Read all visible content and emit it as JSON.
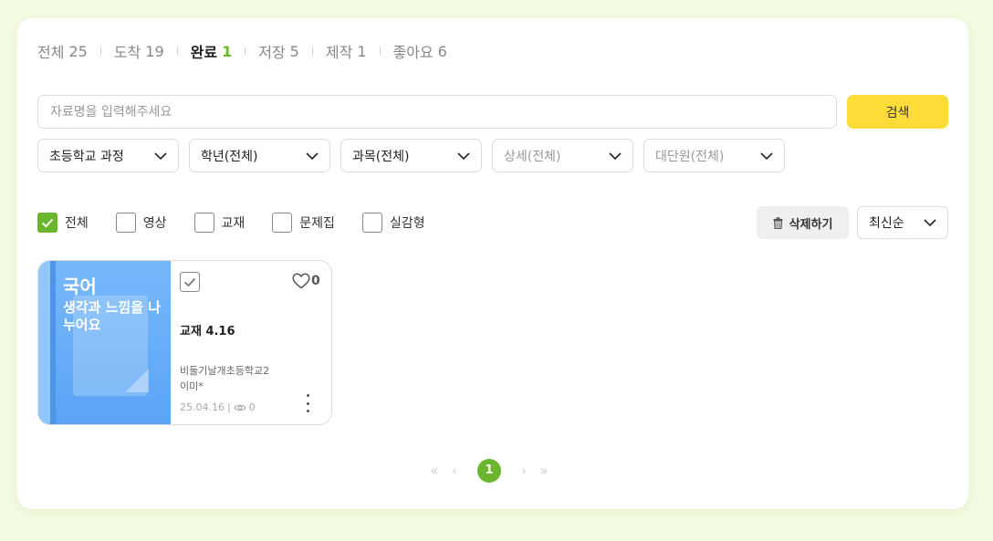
{
  "tabs": [
    {
      "label": "전체",
      "count": "25",
      "active": false
    },
    {
      "label": "도착",
      "count": "19",
      "active": false
    },
    {
      "label": "완료",
      "count": "1",
      "active": true
    },
    {
      "label": "저장",
      "count": "5",
      "active": false
    },
    {
      "label": "제작",
      "count": "1",
      "active": false
    },
    {
      "label": "좋아요",
      "count": "6",
      "active": false
    }
  ],
  "search": {
    "placeholder": "자료명을 입력해주세요",
    "value": "",
    "button": "검색"
  },
  "selects": [
    {
      "value": "초등학교 과정",
      "placeholder": false
    },
    {
      "value": "학년(전체)",
      "placeholder": false
    },
    {
      "value": "과목(전체)",
      "placeholder": false
    },
    {
      "value": "상세(전체)",
      "placeholder": true
    },
    {
      "value": "대단원(전체)",
      "placeholder": true
    }
  ],
  "filters": [
    {
      "label": "전체",
      "checked": true
    },
    {
      "label": "영상",
      "checked": false
    },
    {
      "label": "교재",
      "checked": false
    },
    {
      "label": "문제집",
      "checked": false
    },
    {
      "label": "실감형",
      "checked": false
    }
  ],
  "actions": {
    "delete_label": "삭제하기",
    "sort_value": "최신순"
  },
  "card": {
    "subject": "국어",
    "thumb_title": "생각과 느낌을 나누어요",
    "title": "교재 4.16",
    "school": "비둘기날개초등학교2",
    "author": "이미*",
    "date": "25.04.16",
    "views": "0",
    "likes": "0"
  },
  "pagination": {
    "current": "1"
  },
  "colors": {
    "accent_green": "#6ab72e",
    "search_yellow": "#fddc3a",
    "thumb_blue": "#5aa3f6"
  }
}
